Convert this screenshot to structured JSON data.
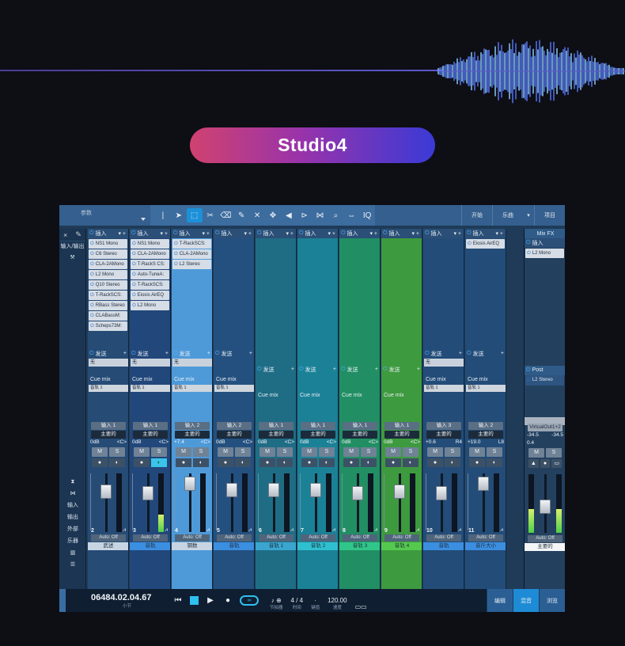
{
  "title": "Studio4",
  "accent_colors": {
    "pill_start": "#d0426f",
    "pill_end": "#3a3ad6",
    "active_blue": "#1c90d8"
  },
  "toolbar": {
    "song_label": "参数",
    "right_buttons": [
      "开始",
      "乐曲",
      "项目"
    ]
  },
  "left_panel": {
    "top_labels": [
      "×",
      "✎"
    ],
    "io_label": "输入/输出",
    "lower_items": [
      "输入",
      "输出",
      "外部",
      "乐器"
    ]
  },
  "strings": {
    "insert": "插入",
    "send": "发送",
    "cue_mix": "Cue mix",
    "track_hdr": "音轨 1",
    "none": "无",
    "auto_off": "Auto: Off",
    "main": "主要的",
    "m": "M",
    "s": "S"
  },
  "channels": [
    {
      "plugins": [
        "NS1 Mono",
        "C6 Stereo",
        "CLA-2AMono",
        "L2 Mono",
        "Q10 Stereo",
        "T-RackSCS:",
        "RBass Stereo",
        "CLABassM:",
        "Scheps73M:"
      ],
      "input": "输入 1",
      "pan_l": "0dB",
      "pan_r": "<C>",
      "num": "2",
      "name": "武述",
      "send_value": "无",
      "color": "#264b75",
      "name_bg": "#c7d5e3"
    },
    {
      "plugins": [
        "NS1 Mono",
        "CLA-2AMono",
        "T-RackS CS:",
        "Auto-TuneA:",
        "T-RackSCS:",
        "Eiosis AirEQ",
        "L2 Mono"
      ],
      "input": "输入 1",
      "pan_l": "0dB",
      "pan_r": "<C>",
      "num": "3",
      "name": "音轨",
      "send_value": "无",
      "color": "#22477a",
      "name_bg": "#3b8ee0"
    },
    {
      "plugins": [
        "T-RackSCS:",
        "CLA-2AMono",
        "L2 Stereo"
      ],
      "input": "输入 2",
      "pan_l": "+7.4",
      "pan_r": "<C>",
      "num": "4",
      "name": "钢数",
      "send_value": "无",
      "color": "#4e9ad9",
      "name_bg": "#c7d5e3"
    },
    {
      "plugins": [],
      "input": "输入 2",
      "pan_l": "0dB",
      "pan_r": "<C>",
      "num": "5",
      "name": "音轨",
      "send_value": "",
      "color": "#24507f",
      "name_bg": "#3b8ee0"
    },
    {
      "plugins": [],
      "input": "输入 1",
      "pan_l": "0dB",
      "pan_r": "<C>",
      "num": "6",
      "name": "音轨 1",
      "send_value": "",
      "color": "#1f6d85",
      "name_bg": "#3aa6cf"
    },
    {
      "plugins": [],
      "input": "输入 1",
      "pan_l": "0dB",
      "pan_r": "<C>",
      "num": "7",
      "name": "音轨 2",
      "send_value": "",
      "color": "#1b8196",
      "name_bg": "#2fc0cf"
    },
    {
      "plugins": [],
      "input": "输入 1",
      "pan_l": "0dB",
      "pan_r": "<C>",
      "num": "8",
      "name": "音轨 3",
      "send_value": "",
      "color": "#218f63",
      "name_bg": "#30c689"
    },
    {
      "plugins": [],
      "input": "输入 1",
      "pan_l": "0dB",
      "pan_r": "<C>",
      "num": "9",
      "name": "音轨 4",
      "send_value": "",
      "color": "#3e9a3e",
      "name_bg": "#55c94e"
    },
    {
      "plugins": [],
      "input": "输入 3",
      "pan_l": "+0.6",
      "pan_r": "R4",
      "num": "10",
      "name": "音轨",
      "send_value": "无",
      "color": "#234c78",
      "name_bg": "#3b8ee0"
    },
    {
      "plugins": [
        "Eiosis AirEQ"
      ],
      "input": "输入 2",
      "pan_l": "+19.0",
      "pan_r": "L8",
      "num": "11",
      "name": "音斤大小",
      "send_value": "",
      "color": "#234c78",
      "name_bg": "#3b8ee0"
    }
  ],
  "mixfx": {
    "title": "Mix FX",
    "insert": "插入",
    "plugin": "L2 Mono",
    "post": "Post",
    "post_plugin": "L2 Stereo",
    "out": "VirtualOut1+2",
    "lvl_l": "-34.5",
    "lvl_r": "-34.5",
    "val": "0.4",
    "auto": "Auto: Off",
    "name": "主要的"
  },
  "transport": {
    "time": "06484.02.04.67",
    "time_unit": "小节",
    "loop": "∞",
    "sig": "4 / 4",
    "sig_label": "时间",
    "key_label": "键值",
    "tempo": "120.00",
    "tempo_label": "速度",
    "metronome_label": "节拍器"
  },
  "modes": [
    "编辑",
    "混音",
    "浏览"
  ]
}
